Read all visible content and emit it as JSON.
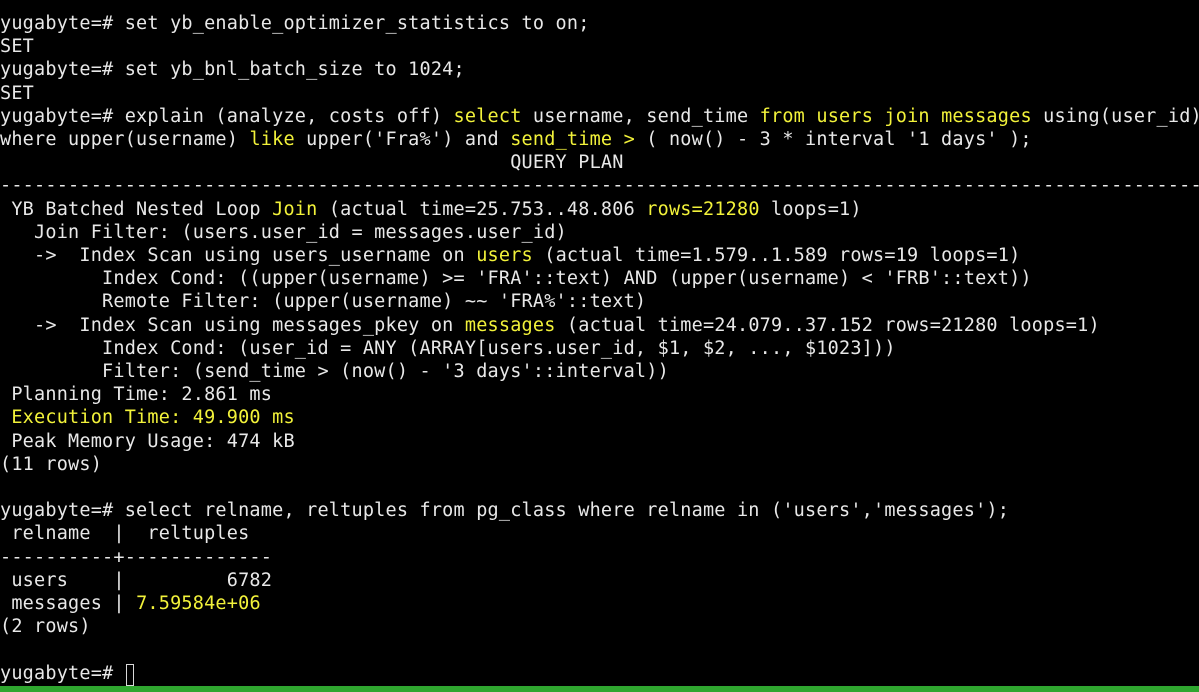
{
  "terminal": {
    "background": "#000000",
    "foreground": "#e8e8e8",
    "highlight_color": "#f2f23a",
    "status_bar_color": "#2fa62f",
    "lines": [
      {
        "segments": [
          {
            "t": "yugabyte=# set yb_enable_optimizer_statistics to on;"
          }
        ]
      },
      {
        "segments": [
          {
            "t": "SET"
          }
        ]
      },
      {
        "segments": [
          {
            "t": "yugabyte=# set yb_bnl_batch_size to 1024;"
          }
        ]
      },
      {
        "segments": [
          {
            "t": "SET"
          }
        ]
      },
      {
        "segments": [
          {
            "t": "yugabyte=# explain (analyze, costs off) "
          },
          {
            "t": "select",
            "hl": true
          },
          {
            "t": " username, send_time "
          },
          {
            "t": "from users join messages",
            "hl": true
          },
          {
            "t": " using(user_id)"
          }
        ]
      },
      {
        "segments": [
          {
            "t": "where upper(username) "
          },
          {
            "t": "like",
            "hl": true
          },
          {
            "t": " upper('Fra%') and "
          },
          {
            "t": "send_time >",
            "hl": true
          },
          {
            "t": " ( now() - 3 * interval '1 days' );"
          }
        ]
      },
      {
        "segments": [
          {
            "t": "                                             QUERY PLAN"
          }
        ]
      },
      {
        "segments": [
          {
            "t": "-----------------------------------------------------------------------------------------------------------------"
          }
        ]
      },
      {
        "segments": [
          {
            "t": " YB Batched Nested Loop "
          },
          {
            "t": "Join",
            "hl": true
          },
          {
            "t": " (actual time=25.753..48.806 "
          },
          {
            "t": "rows=21280",
            "hl": true
          },
          {
            "t": " loops=1)"
          }
        ]
      },
      {
        "segments": [
          {
            "t": "   Join Filter: (users.user_id = messages.user_id)"
          }
        ]
      },
      {
        "segments": [
          {
            "t": "   ->  Index Scan using users_username on "
          },
          {
            "t": "users",
            "hl": true
          },
          {
            "t": " (actual time=1.579..1.589 rows=19 loops=1)"
          }
        ]
      },
      {
        "segments": [
          {
            "t": "         Index Cond: ((upper(username) >= 'FRA'::text) AND (upper(username) < 'FRB'::text))"
          }
        ]
      },
      {
        "segments": [
          {
            "t": "         Remote Filter: (upper(username) ~~ 'FRA%'::text)"
          }
        ]
      },
      {
        "segments": [
          {
            "t": "   ->  Index Scan using messages_pkey on "
          },
          {
            "t": "messages",
            "hl": true
          },
          {
            "t": " (actual time=24.079..37.152 rows=21280 loops=1)"
          }
        ]
      },
      {
        "segments": [
          {
            "t": "         Index Cond: (user_id = ANY (ARRAY[users.user_id, $1, $2, ..., $1023]))"
          }
        ]
      },
      {
        "segments": [
          {
            "t": "         Filter: (send_time > (now() - '3 days'::interval))"
          }
        ]
      },
      {
        "segments": [
          {
            "t": " Planning Time: 2.861 ms"
          }
        ]
      },
      {
        "segments": [
          {
            "t": " Execution Time: 49.900 ms",
            "hl": true
          }
        ]
      },
      {
        "segments": [
          {
            "t": " Peak Memory Usage: 474 kB"
          }
        ]
      },
      {
        "segments": [
          {
            "t": "(11 rows)"
          }
        ]
      },
      {
        "segments": []
      },
      {
        "segments": [
          {
            "t": "yugabyte=# select relname, reltuples from pg_class where relname in ('users','messages');"
          }
        ]
      },
      {
        "segments": [
          {
            "t": " relname  |  reltuples"
          }
        ]
      },
      {
        "segments": [
          {
            "t": "----------+-------------"
          }
        ]
      },
      {
        "segments": [
          {
            "t": " users    |         6782"
          }
        ]
      },
      {
        "segments": [
          {
            "t": " messages | "
          },
          {
            "t": "7.59584e+06",
            "hl": true
          }
        ]
      },
      {
        "segments": [
          {
            "t": "(2 rows)"
          }
        ]
      },
      {
        "segments": []
      },
      {
        "segments": [
          {
            "t": "yugabyte=# "
          }
        ]
      }
    ]
  }
}
